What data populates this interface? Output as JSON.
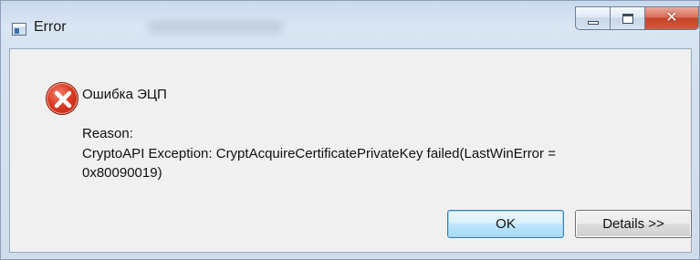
{
  "window": {
    "title": "Error",
    "close_glyph": "✕",
    "caption_buttons": [
      "minimize-icon",
      "maximize-icon",
      "close-icon"
    ],
    "title_icon": "app-window-icon"
  },
  "message": {
    "icon": "error-icon",
    "heading": "Ошибка ЭЦП",
    "reason_label": "Reason:",
    "details_line1": "CryptoAPI Exception: CryptAcquireCertificatePrivateKey failed(LastWinError =",
    "details_line2": "0x80090019)"
  },
  "buttons": {
    "ok_label": "OK",
    "details_label": "Details >>"
  },
  "colors": {
    "error_red": "#dc3b22",
    "close_button": "#c7432a",
    "default_button_border": "#3c7fb1",
    "dialog_background": "#f0f0f0"
  }
}
